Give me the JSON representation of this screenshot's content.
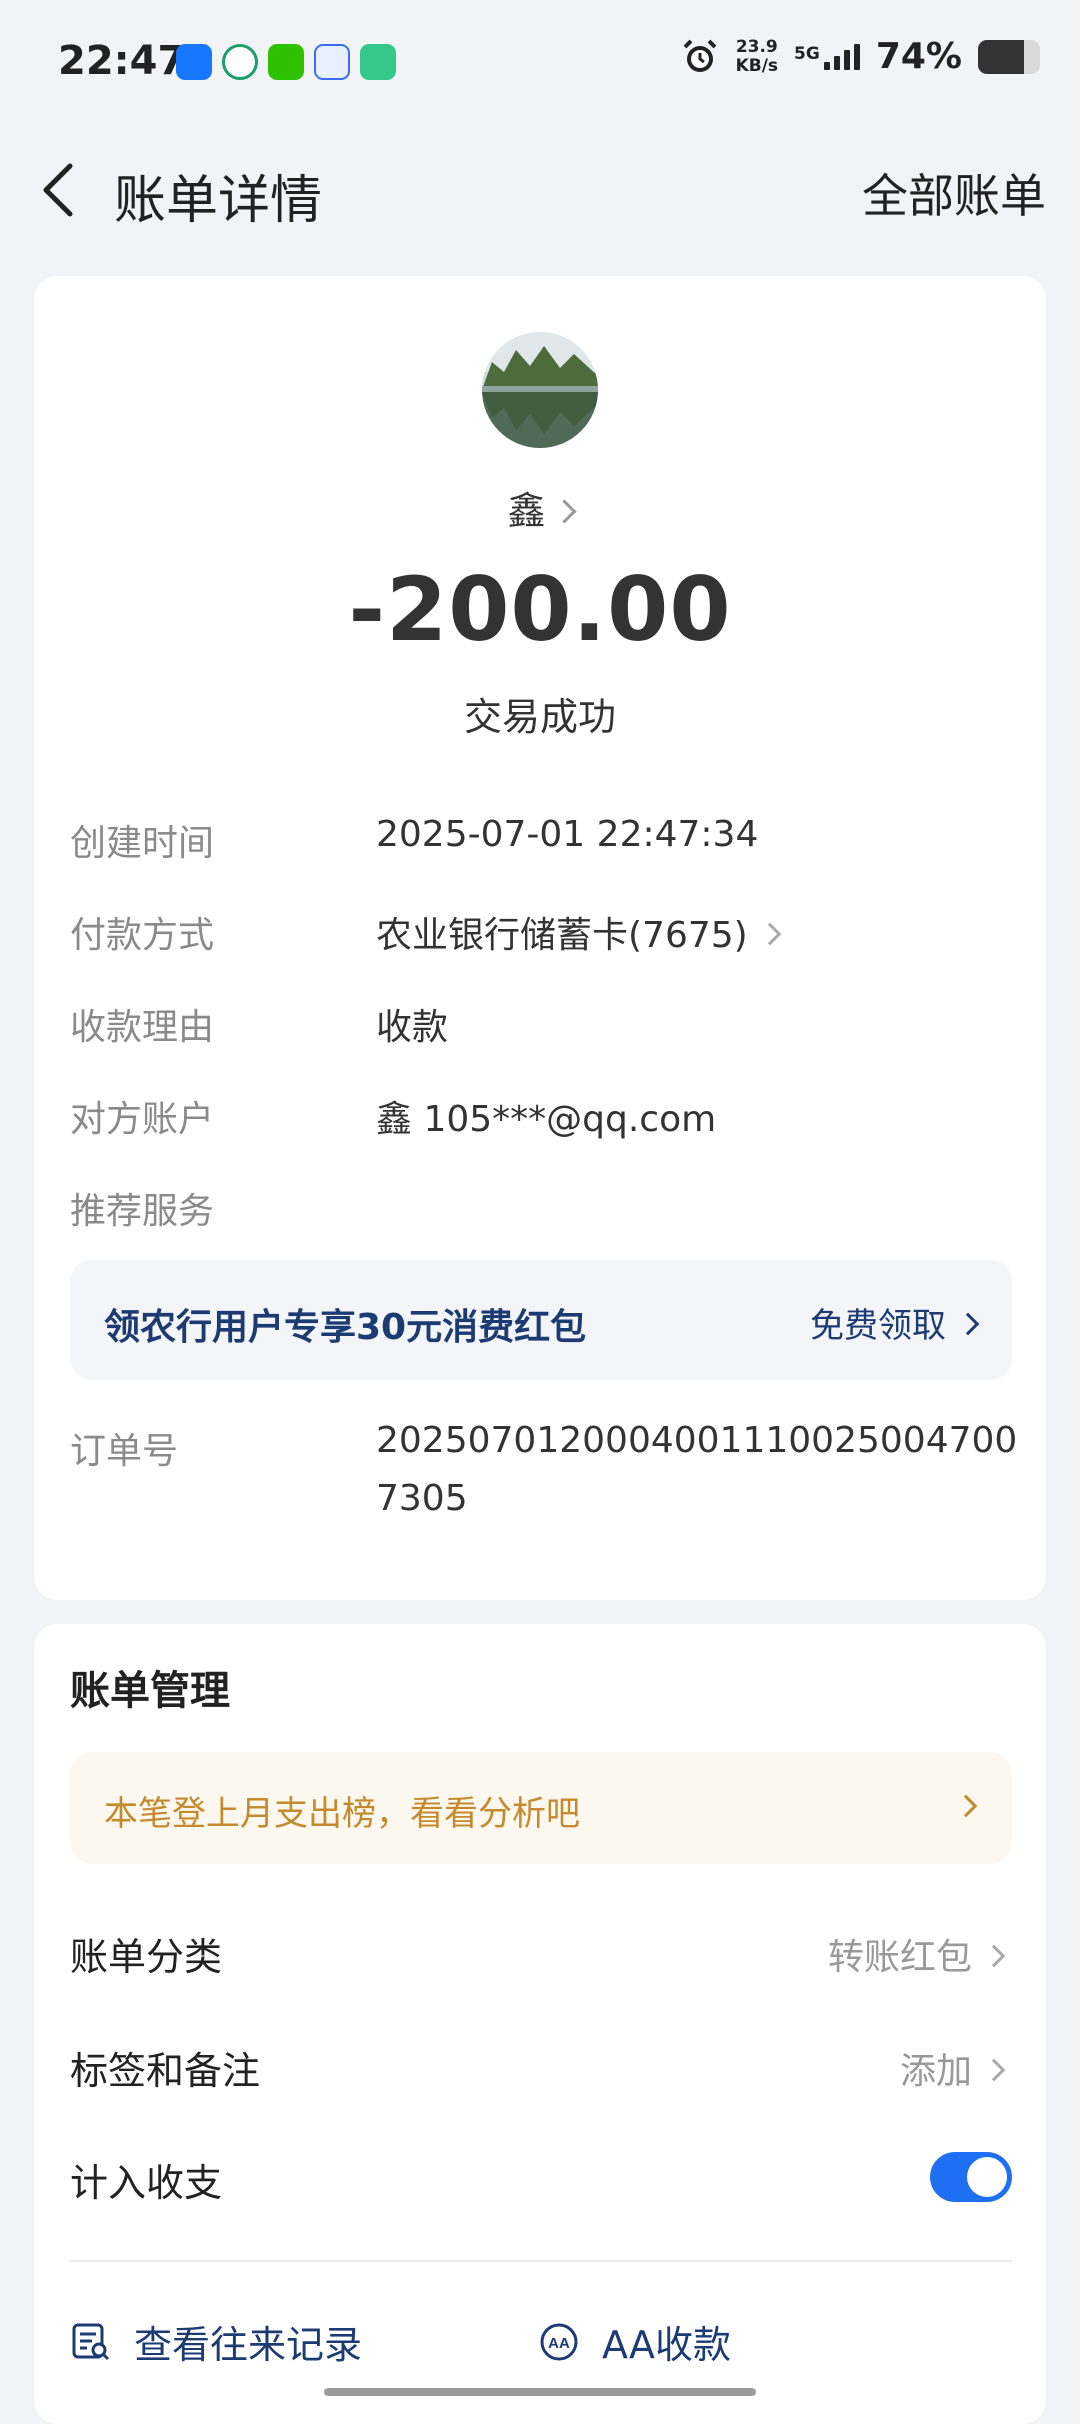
{
  "status_bar": {
    "time": "22:47",
    "net_speed": "23.9",
    "net_unit": "KB/s",
    "signal": "5G",
    "battery_pct": "74%",
    "battery_level": 0.74,
    "app_icons": [
      "alipay-icon",
      "abc-bank-icon",
      "wechat-icon",
      "sms-app-icon",
      "heart-app-icon"
    ]
  },
  "header": {
    "title": "账单详情",
    "right_link": "全部账单"
  },
  "transaction": {
    "payee": "鑫",
    "amount": "-200.00",
    "status": "交易成功"
  },
  "details": [
    {
      "label": "创建时间",
      "value": "2025-07-01 22:47:34"
    },
    {
      "label": "付款方式",
      "value": "农业银行储蓄卡(7675)"
    },
    {
      "label": "收款理由",
      "value": "收款"
    },
    {
      "label": "对方账户",
      "value": "鑫 105***@qq.com"
    },
    {
      "label": "推荐服务",
      "value": ""
    }
  ],
  "promo": {
    "text": "领农行用户专享30元消费红包",
    "cta": "免费领取"
  },
  "order": {
    "label": "订单号",
    "value": "20250701200040011100250047007305"
  },
  "bill_management": {
    "title": "账单管理",
    "tip": "本笔登上月支出榜，看看分析吧",
    "rows": [
      {
        "label": "账单分类",
        "value": "转账红包"
      },
      {
        "label": "标签和备注",
        "value": "添加"
      },
      {
        "label": "计入收支",
        "value": ""
      }
    ],
    "toggle_on": true,
    "actions": [
      {
        "label": "查看往来记录",
        "icon": "records-icon"
      },
      {
        "label": "AA收款",
        "icon": "aa-icon"
      }
    ]
  },
  "colors": {
    "accent_blue": "#1f6ff2",
    "navy_text": "#1d3b73",
    "tip_text": "#c58a2b"
  }
}
